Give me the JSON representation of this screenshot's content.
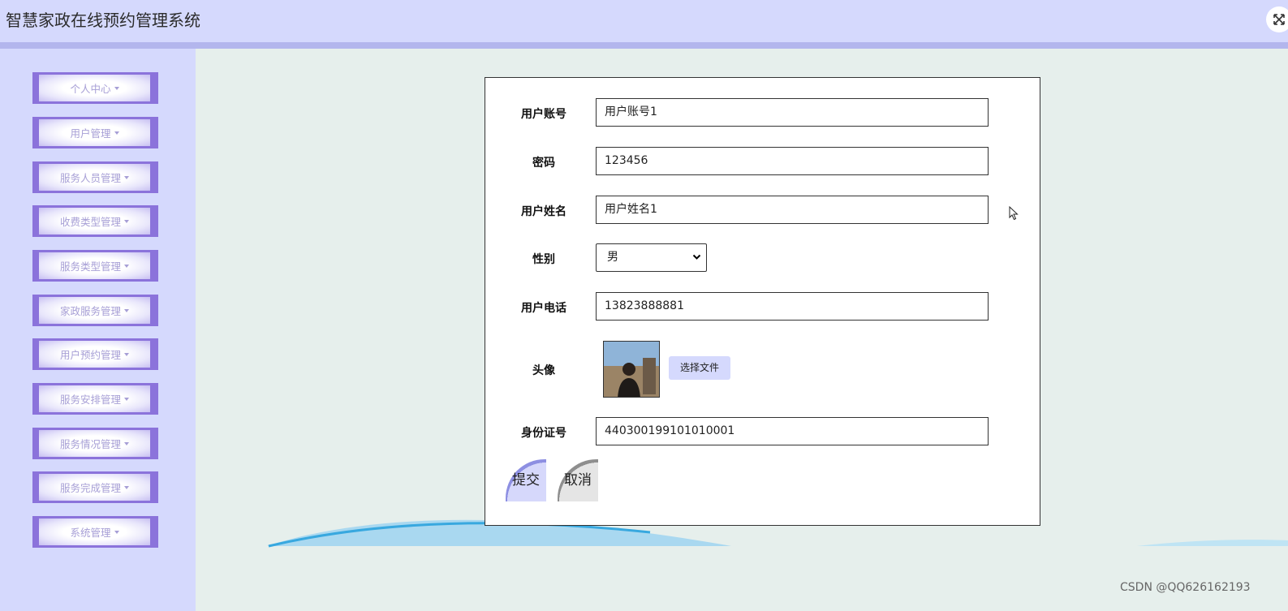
{
  "header": {
    "title": "智慧家政在线预约管理系统",
    "fullscreen_icon": "expand-icon"
  },
  "sidebar": {
    "items": [
      {
        "label": "个人中心"
      },
      {
        "label": "用户管理"
      },
      {
        "label": "服务人员管理"
      },
      {
        "label": "收费类型管理"
      },
      {
        "label": "服务类型管理"
      },
      {
        "label": "家政服务管理"
      },
      {
        "label": "用户预约管理"
      },
      {
        "label": "服务安排管理"
      },
      {
        "label": "服务情况管理"
      },
      {
        "label": "服务完成管理"
      },
      {
        "label": "系统管理"
      }
    ]
  },
  "form": {
    "account": {
      "label": "用户账号",
      "value": "用户账号1"
    },
    "password": {
      "label": "密码",
      "value": "123456"
    },
    "name": {
      "label": "用户姓名",
      "value": "用户姓名1"
    },
    "gender": {
      "label": "性别",
      "value": "男"
    },
    "phone": {
      "label": "用户电话",
      "value": "13823888881"
    },
    "avatar": {
      "label": "头像",
      "file_button": "选择文件"
    },
    "id_card": {
      "label": "身份证号",
      "value": "440300199101010001"
    },
    "submit_label": "提交",
    "cancel_label": "取消"
  },
  "watermark": "CSDN @QQ626162193",
  "colors": {
    "header_bg": "#d5d9fd",
    "sidebar_bg": "#d5d9fd",
    "menu_accent": "#8b73db",
    "content_bg": "#e6efec"
  }
}
